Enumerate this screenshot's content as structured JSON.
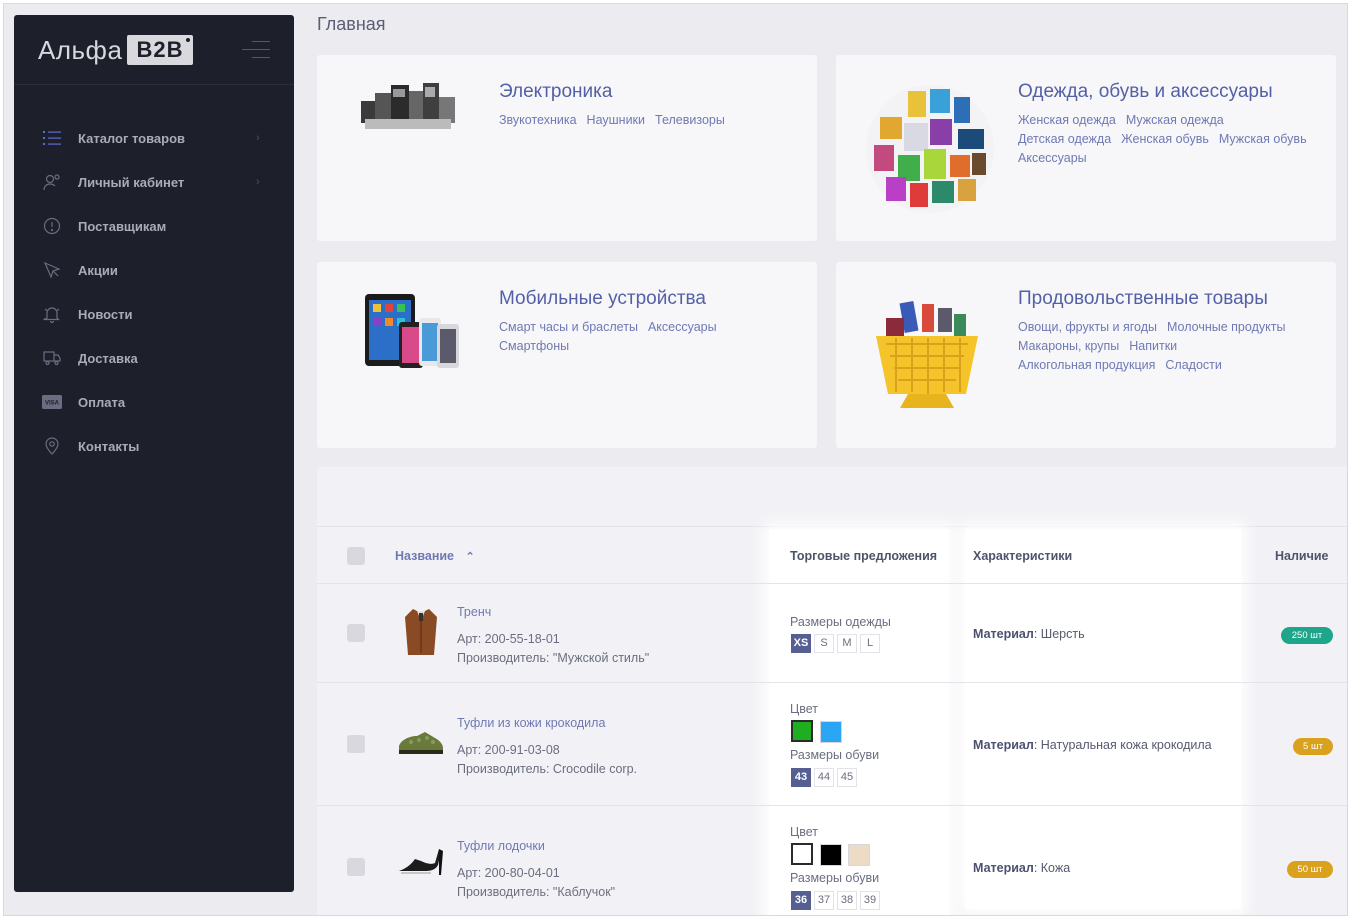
{
  "sidebar": {
    "logo_text": "Альфа",
    "logo_badge": "B2B",
    "items": [
      {
        "label": "Каталог товаров",
        "icon": "list-icon",
        "has_arrow": true
      },
      {
        "label": "Личный кабинет",
        "icon": "user-settings-icon",
        "has_arrow": true
      },
      {
        "label": "Поставщикам",
        "icon": "info-circle-icon",
        "has_arrow": false
      },
      {
        "label": "Акции",
        "icon": "megaphone-icon",
        "has_arrow": false
      },
      {
        "label": "Новости",
        "icon": "bell-icon",
        "has_arrow": false
      },
      {
        "label": "Доставка",
        "icon": "truck-icon",
        "has_arrow": false
      },
      {
        "label": "Оплата",
        "icon": "visa-card-icon",
        "has_arrow": false
      },
      {
        "label": "Контакты",
        "icon": "map-pin-icon",
        "has_arrow": false
      }
    ],
    "arrow": "›"
  },
  "main": {
    "title": "Главная",
    "categories": [
      {
        "title": "Электроника",
        "links": [
          "Звукотехника",
          "Наушники",
          "Телевизоры"
        ]
      },
      {
        "title": "Одежда, обувь и аксессуары",
        "links": [
          "Женская одежда",
          "Мужская одежда",
          "Детская одежда",
          "Женская обувь",
          "Мужская обувь",
          "Аксессуары"
        ]
      },
      {
        "title": "Мобильные устройства",
        "links": [
          "Смарт часы и браслеты",
          "Аксессуары",
          "Смартфоны"
        ]
      },
      {
        "title": "Продовольственные товары",
        "links": [
          "Овощи, фрукты и ягоды",
          "Молочные продукты",
          "Макароны, крупы",
          "Напитки",
          "Алкогольная продукция",
          "Сладости"
        ]
      }
    ]
  },
  "table": {
    "headers": {
      "name": "Название",
      "sort_arrow": "⌃",
      "offers": "Торговые предложения",
      "specs": "Характеристики",
      "stock": "Наличие"
    },
    "rows": [
      {
        "name": "Тренч",
        "article": "Арт: 200-55-18-01",
        "maker": "Производитель: \"Мужской стиль\"",
        "offer_groups": [
          {
            "label": "Размеры одежды",
            "type": "size",
            "options": [
              "XS",
              "S",
              "M",
              "L"
            ],
            "selected": 0
          }
        ],
        "spec_label": "Материал",
        "spec_value": ": Шерсть",
        "stock": "250 шт",
        "stock_color": "#1fa58a"
      },
      {
        "name": "Туфли из кожи крокодила",
        "article": "Арт: 200-91-03-08",
        "maker": "Производитель: Crocodile corp.",
        "offer_groups": [
          {
            "label": "Цвет",
            "type": "color",
            "options": [
              "#1fae1f",
              "#2aa6f5"
            ],
            "selected": 0
          },
          {
            "label": "Размеры обуви",
            "type": "size",
            "options": [
              "43",
              "44",
              "45"
            ],
            "selected": 0
          }
        ],
        "spec_label": "Материал",
        "spec_value": ": Натуральная кожа крокодила",
        "stock": "5 шт",
        "stock_color": "#d9a11c"
      },
      {
        "name": "Туфли лодочки",
        "article": "Арт: 200-80-04-01",
        "maker": "Производитель: \"Каблучок\"",
        "offer_groups": [
          {
            "label": "Цвет",
            "type": "color",
            "options": [
              "#ffffff",
              "#000000",
              "#ecdcc6"
            ],
            "selected": 0
          },
          {
            "label": "Размеры обуви",
            "type": "size",
            "options": [
              "36",
              "37",
              "38",
              "39"
            ],
            "selected": 0
          }
        ],
        "spec_label": "Материал",
        "spec_value": ": Кожа",
        "stock": "50 шт",
        "stock_color": "#d9a11c"
      }
    ]
  }
}
